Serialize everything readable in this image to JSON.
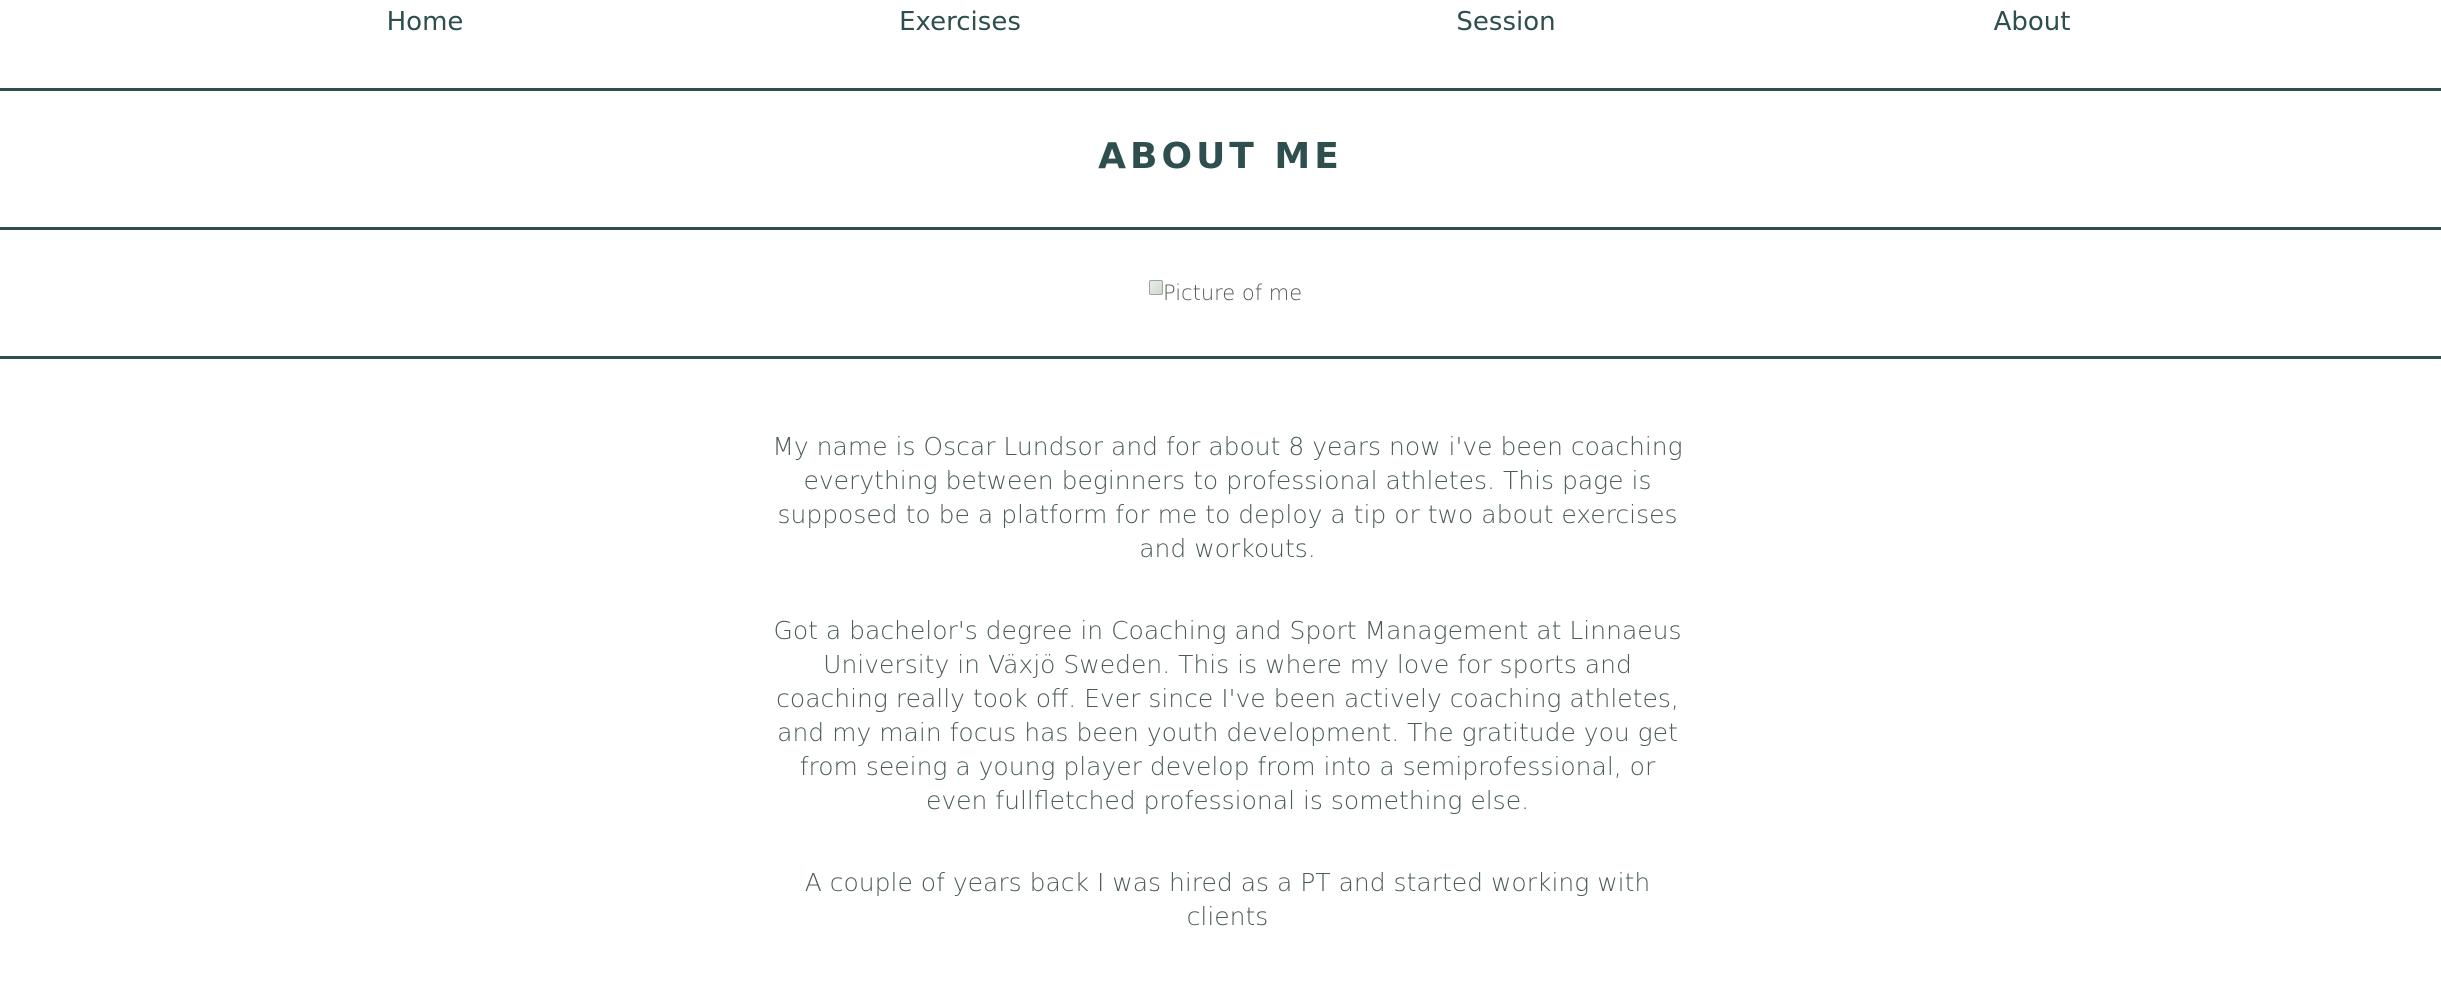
{
  "nav": {
    "items": [
      {
        "label": "Home"
      },
      {
        "label": "Exercises"
      },
      {
        "label": "Session"
      },
      {
        "label": "About"
      }
    ]
  },
  "page": {
    "title": "ABOUT ME"
  },
  "profile_image": {
    "alt": "Picture of me"
  },
  "content": {
    "paragraphs": [
      "My name is Oscar Lundsor and for about 8 years now i've been coaching everything between beginners to professional athletes. This page is supposed to be a platform for me to deploy a tip or two about exercises and workouts.",
      "Got a bachelor's degree in Coaching and Sport Management at Linnaeus University in Växjö Sweden. This is where my love for sports and coaching really took off. Ever since I've been actively coaching athletes, and my main focus has been youth development. The gratitude you get from seeing a young player develop from into a semiprofessional, or even fullfletched professional is something else.",
      "A couple of years back I was hired as a PT and started working with clients"
    ]
  },
  "colors": {
    "primary": "#2f4f4f",
    "text": "#4b5a5a",
    "background": "#ffffff"
  }
}
